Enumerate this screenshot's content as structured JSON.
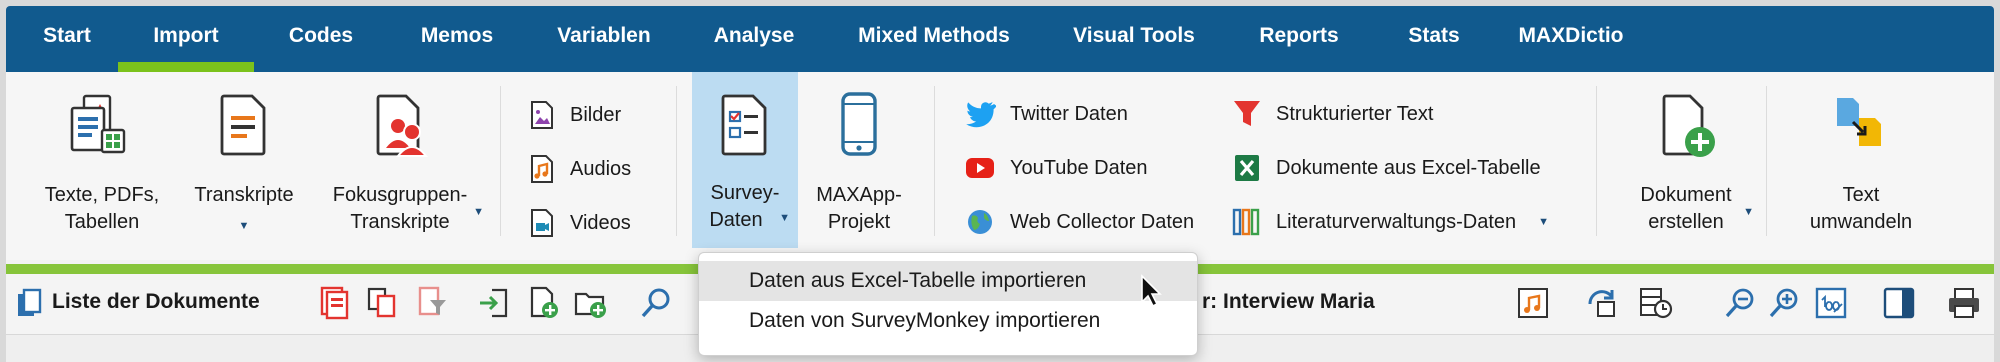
{
  "menu": {
    "tabs": [
      {
        "label": "Start"
      },
      {
        "label": "Import"
      },
      {
        "label": "Codes"
      },
      {
        "label": "Memos"
      },
      {
        "label": "Variablen"
      },
      {
        "label": "Analyse"
      },
      {
        "label": "Mixed Methods"
      },
      {
        "label": "Visual Tools"
      },
      {
        "label": "Reports"
      },
      {
        "label": "Stats"
      },
      {
        "label": "MAXDictio"
      }
    ],
    "active": "Import"
  },
  "ribbon": {
    "texte": {
      "line1": "Texte, PDFs,",
      "line2": "Tabellen"
    },
    "transkripte": {
      "line1": "Transkripte"
    },
    "fokus": {
      "line1": "Fokusgruppen-",
      "line2": "Transkripte"
    },
    "media": [
      "Bilder",
      "Audios",
      "Videos"
    ],
    "survey": {
      "line1": "Survey-",
      "line2": "Daten"
    },
    "maxapp": {
      "line1": "MAXApp-",
      "line2": "Projekt"
    },
    "web": [
      "Twitter Daten",
      "YouTube Daten",
      "Web Collector Daten"
    ],
    "struct": [
      "Strukturierter Text",
      "Dokumente aus Excel-Tabelle",
      "Literaturverwaltungs-Daten"
    ],
    "dokument": {
      "line1": "Dokument",
      "line2": "erstellen"
    },
    "text_umwandeln": {
      "line1": "Text",
      "line2": "umwandeln"
    }
  },
  "toolbar": {
    "title": "Liste der Dokumente",
    "doc_title": "r: Interview Maria"
  },
  "dropdown": {
    "items": [
      "Daten aus Excel-Tabelle importieren",
      "Daten von SurveyMonkey importieren"
    ]
  },
  "colors": {
    "menubar": "#115a8e",
    "accent_green": "#7bc21c",
    "selected": "#bcdcf2"
  }
}
